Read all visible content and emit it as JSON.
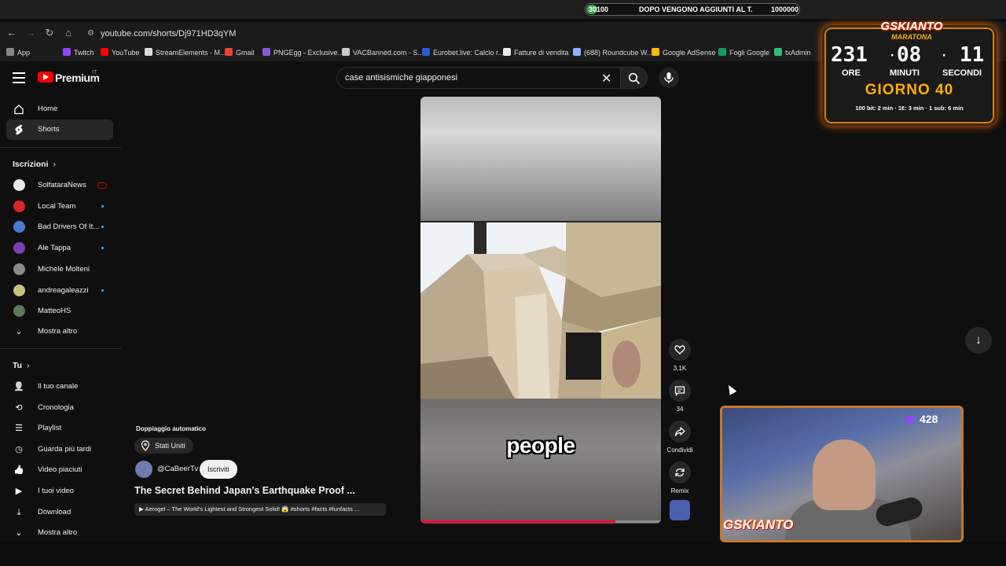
{
  "goal_bar": {
    "start": "30100",
    "text": "DOPO VENGONO AGGIUNTI AL T.",
    "end": "1000000",
    "progress": 0.03
  },
  "browser": {
    "url": "youtube.com/shorts/Dj971HD3qYM"
  },
  "bookmarks": [
    {
      "label": "App",
      "color": "#888"
    },
    {
      "label": "Twitch",
      "color": "#9146ff"
    },
    {
      "label": "YouTube",
      "color": "#ff0000"
    },
    {
      "label": "StreamElements - M...",
      "color": "#dddddd"
    },
    {
      "label": "Gmail",
      "color": "#ea4335"
    },
    {
      "label": "PNGEgg - Exclusive...",
      "color": "#8a5ad6"
    },
    {
      "label": "VACBanned.com - S...",
      "color": "#cccccc"
    },
    {
      "label": "Eurobet.live: Calcio r...",
      "color": "#2a5bd7"
    },
    {
      "label": "Fatture di vendita",
      "color": "#e9e9e9"
    },
    {
      "label": "(688) Roundcube W...",
      "color": "#8ab4f8"
    },
    {
      "label": "Google AdSense",
      "color": "#fbbc04"
    },
    {
      "label": "Fogli Google",
      "color": "#0f9d58"
    },
    {
      "label": "txAdmin",
      "color": "#2fbf71"
    }
  ],
  "header": {
    "logo": "Premium",
    "country": "IT",
    "search_query": "case antisismiche giapponesi"
  },
  "sidebar": {
    "home": "Home",
    "shorts": "Shorts",
    "subscriptions_title": "Iscrizioni",
    "subscriptions": [
      {
        "name": "SolfataraNews",
        "color": "#e8e8e8",
        "badge": "live"
      },
      {
        "name": "Local Team",
        "color": "#d62828",
        "badge": "dot"
      },
      {
        "name": "Bad Drivers Of It...",
        "color": "#4a7bd0",
        "badge": "dot"
      },
      {
        "name": "Ale Tappa",
        "color": "#7a3fb0",
        "badge": "dot"
      },
      {
        "name": "Michele Molteni",
        "color": "#8a8a8a",
        "badge": ""
      },
      {
        "name": "andreagaleazzi",
        "color": "#c9c27a",
        "badge": "dot"
      },
      {
        "name": "MatteoHS",
        "color": "#5a7a5a",
        "badge": ""
      }
    ],
    "show_more": "Mostra altro",
    "you_title": "Tu",
    "you_items": [
      "Il tuo canale",
      "Cronologia",
      "Playlist",
      "Guarda più tardi",
      "Video piaciuti",
      "I tuoi video",
      "Download",
      "Mostra altro"
    ]
  },
  "video": {
    "caption": "people",
    "progress": 0.81,
    "dubbing": "Doppiaggio automatico",
    "location": "Stati Uniti",
    "channel": "@CaBeerTv",
    "subscribe": "Iscriviti",
    "title": "The Secret Behind Japan's Earthquake Proof ...",
    "related": "▶ Aerogel – The World's Lightest and Strongest Solid! 😱 #shorts #facts #funfacts ..."
  },
  "actions": {
    "likes": "3,1K",
    "comments": "34",
    "share": "Condividi",
    "remix": "Remix"
  },
  "overlay": {
    "brand": "GSKIANTO",
    "subtitle": "MARATONA",
    "hours": "231",
    "minutes": "08",
    "seconds": "11",
    "hours_label": "ORE",
    "minutes_label": "MINUTI",
    "seconds_label": "SECONDI",
    "day": "GIORNO 40",
    "info": "100 bit: 2 min · 1€: 3 min · 1 sub: 6 min",
    "viewers": "428",
    "cam_brand": "GSKIANTO"
  }
}
